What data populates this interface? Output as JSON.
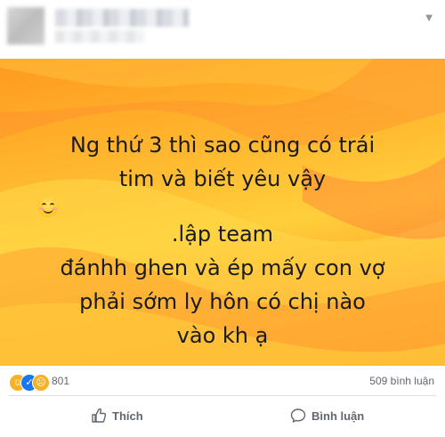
{
  "status": {
    "lines": [
      "Ng thứ 3 thì sao cũng có trái",
      "tim và biết yêu vậy",
      " .lập team",
      "đánhh ghen và ép mấy con vợ",
      "phải sớm ly hôn có chị nào",
      "vào kh ạ"
    ],
    "emoji": "smiling-face-emoji"
  },
  "reactions": {
    "icons": [
      "haha-icon",
      "like-icon",
      "sad-icon"
    ],
    "count": "801",
    "comments": "509 bình luận"
  },
  "actions": {
    "like_label": "Thích",
    "comment_label": "Bình luận"
  },
  "colors": {
    "bg_top": "#ff9a1f",
    "bg_mid": "#ffcf3a",
    "accent_blue": "#1877f2",
    "muted_text": "#606770"
  }
}
